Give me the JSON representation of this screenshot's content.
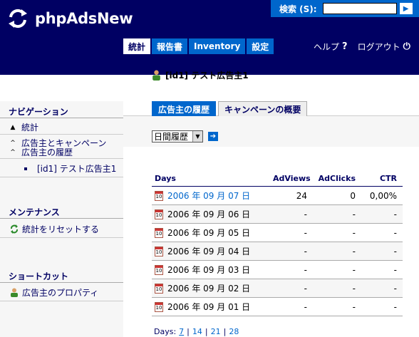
{
  "header": {
    "logo_text": "phpAdsNew",
    "search_label": "検索 (S):",
    "search_value": ""
  },
  "tabs": [
    {
      "label": "統計",
      "active": true
    },
    {
      "label": "報告書",
      "active": false
    },
    {
      "label": "Inventory",
      "active": false
    },
    {
      "label": "設定",
      "active": false
    }
  ],
  "topnav": {
    "help_label": "ヘルプ",
    "logout_label": "ログアウト"
  },
  "sidebar": {
    "navigation_heading": "ナビゲーション",
    "nav_items": [
      {
        "label": "統計"
      },
      {
        "label": "広告主とキャンペーン"
      },
      {
        "label": "広告主の履歴"
      },
      {
        "label": "[id1] テスト広告主1"
      }
    ],
    "maintenance_heading": "メンテナンス",
    "maintenance_item": "統計をリセットする",
    "shortcut_heading": "ショートカット",
    "shortcut_item": "広告主のプロパティ"
  },
  "main": {
    "advertiser_title": "[id1] テスト広告主1",
    "subtabs": [
      {
        "label": "広告主の履歴",
        "active": true
      },
      {
        "label": "キャンペーンの概要",
        "active": false
      }
    ],
    "period_select": "日間履歴",
    "table": {
      "headers": {
        "days": "Days",
        "adviews": "AdViews",
        "adclicks": "AdClicks",
        "ctr": "CTR"
      },
      "rows": [
        {
          "day": "2006 年 09 月 07 日",
          "adviews": "24",
          "adclicks": "0",
          "ctr": "0,00%"
        },
        {
          "day": "2006 年 09 月 06 日",
          "adviews": "-",
          "adclicks": "-",
          "ctr": "-"
        },
        {
          "day": "2006 年 09 月 05 日",
          "adviews": "-",
          "adclicks": "-",
          "ctr": "-"
        },
        {
          "day": "2006 年 09 月 04 日",
          "adviews": "-",
          "adclicks": "-",
          "ctr": "-"
        },
        {
          "day": "2006 年 09 月 03 日",
          "adviews": "-",
          "adclicks": "-",
          "ctr": "-"
        },
        {
          "day": "2006 年 09 月 02 日",
          "adviews": "-",
          "adclicks": "-",
          "ctr": "-"
        },
        {
          "day": "2006 年 09 月 01 日",
          "adviews": "-",
          "adclicks": "-",
          "ctr": "-"
        }
      ]
    },
    "pager": {
      "label": "Days:",
      "options": [
        "7",
        "14",
        "21",
        "28"
      ]
    }
  },
  "colors": {
    "header_bg": "#000063",
    "accent": "#0066cc"
  }
}
